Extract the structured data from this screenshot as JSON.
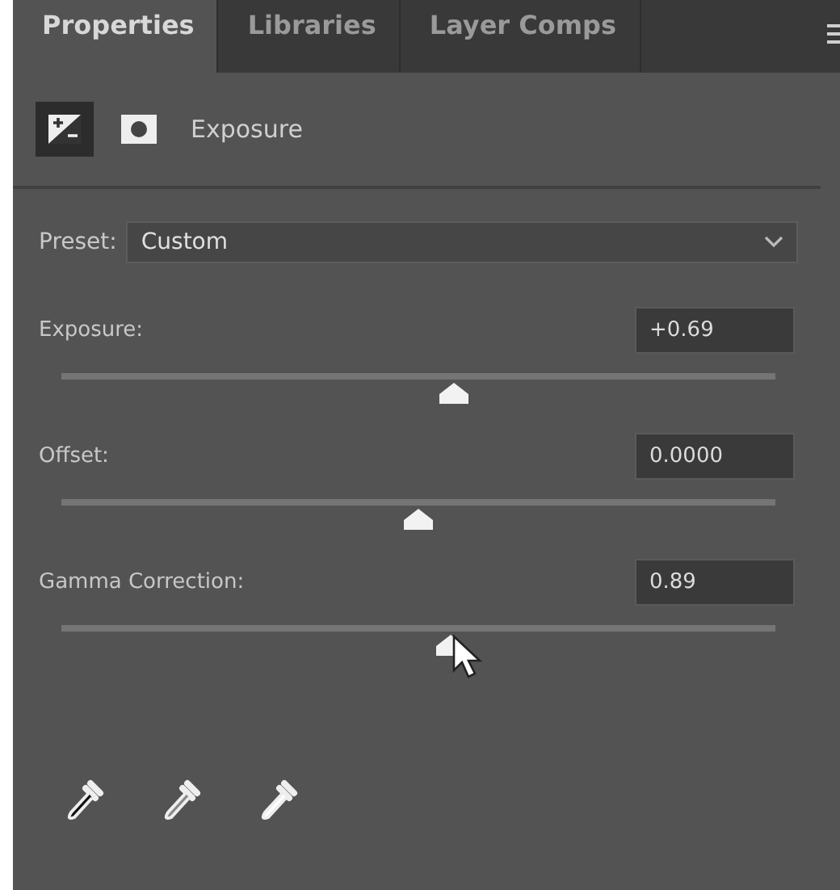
{
  "tabs": [
    {
      "label": "Properties",
      "selected": true
    },
    {
      "label": "Libraries",
      "selected": false
    },
    {
      "label": "Layer Comps",
      "selected": false
    }
  ],
  "header": {
    "buttons": [
      {
        "kind": "adjustment",
        "selected": true
      },
      {
        "kind": "mask",
        "selected": false
      }
    ],
    "title": "Exposure"
  },
  "preset": {
    "label": "Preset:",
    "value": "Custom"
  },
  "sliders": [
    {
      "label": "Exposure:",
      "value": "+0.69",
      "level": 0.55
    },
    {
      "label": "Offset:",
      "value": "0.0000",
      "level": 0.5
    },
    {
      "label": "Gamma Correction:",
      "value": "0.89",
      "level": 0.545
    }
  ],
  "eyedroppers": [
    {
      "kind": "black"
    },
    {
      "kind": "gray"
    },
    {
      "kind": "white"
    }
  ]
}
